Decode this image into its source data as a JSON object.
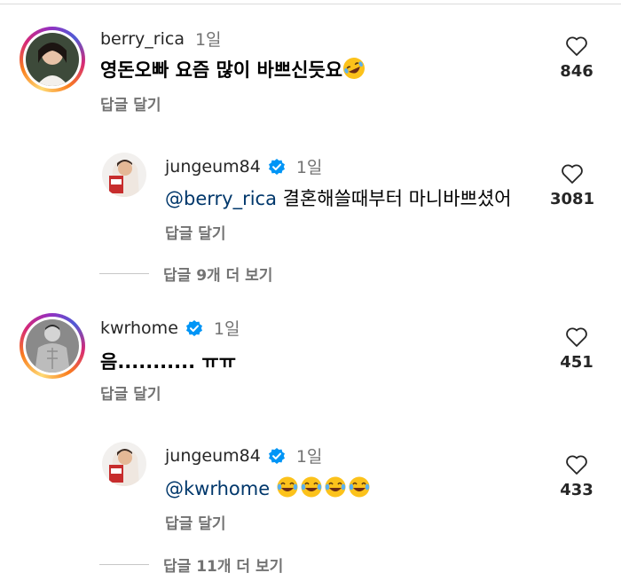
{
  "comments": [
    {
      "username": "berry_rica",
      "time": "1일",
      "text": "영돈오빠 요즘 많이 바쁘신듯요",
      "reply_label": "답글 달기",
      "likes": "846",
      "emoji": "rolling-on-floor-laughing"
    },
    {
      "username": "jungeum84",
      "time": "1일",
      "mention": "@berry_rica",
      "text": "결혼해쓸때부터 마니바쁘셨어",
      "reply_label": "답글 달기",
      "likes": "3081",
      "verified": true
    },
    {
      "more_replies": "답글 9개 더 보기"
    },
    {
      "username": "kwrhome",
      "time": "1일",
      "text": "음........... ㅠㅠ",
      "reply_label": "답글 달기",
      "likes": "451",
      "verified": true
    },
    {
      "username": "jungeum84",
      "time": "1일",
      "mention": "@kwrhome",
      "reply_label": "답글 달기",
      "likes": "433",
      "verified": true,
      "emoji": "face-with-tears-of-joy x4"
    },
    {
      "more_replies": "답글 11개 더 보기"
    }
  ],
  "colors": {
    "verified": "#0095f6",
    "mention": "#00376b",
    "secondary_text": "#737373"
  }
}
